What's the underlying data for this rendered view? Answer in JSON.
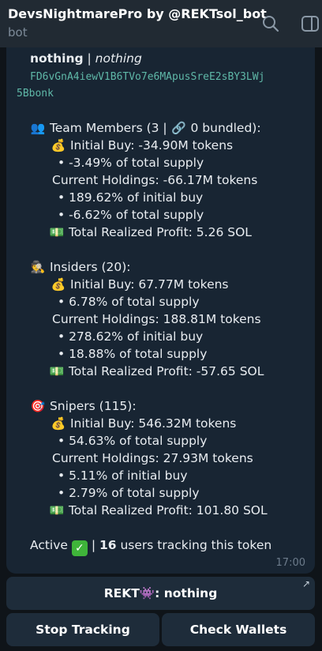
{
  "header": {
    "title": "DevsNightmarePro by @REKTsol_bot",
    "subtitle": "bot",
    "icons": [
      "search-icon",
      "side-panel-icon"
    ]
  },
  "message": {
    "name_bold": "nothing",
    "name_sep": " | ",
    "name_italic": "nothing",
    "address_line1": "FD6vGnA4iewV1B6TVo7e6MApusSreE2sBY3LWj",
    "address_line2": "5Bbonk",
    "team": {
      "emoji": "👥",
      "header": "Team Members (3 | ",
      "link_emoji": "🔗",
      "header_tail": " 0 bundled):",
      "initial_buy": "Initial Buy: -34.90M tokens",
      "initial_pct": "• -3.49% of total supply",
      "holdings": "Current Holdings: -66.17M tokens",
      "holdings_pct_buy": "• 189.62% of initial buy",
      "holdings_pct_supply": "• -6.62% of total supply",
      "profit": "Total Realized Profit: 5.26 SOL"
    },
    "insiders": {
      "emoji": "🕵",
      "header": "Insiders (20):",
      "initial_buy": "Initial Buy: 67.77M tokens",
      "initial_pct": "• 6.78% of total supply",
      "holdings": "Current Holdings: 188.81M tokens",
      "holdings_pct_buy": "• 278.62% of initial buy",
      "holdings_pct_supply": "• 18.88% of total supply",
      "profit": "Total Realized Profit: -57.65 SOL"
    },
    "snipers": {
      "emoji": "🎯",
      "header": "Snipers (115):",
      "initial_buy": "Initial Buy: 546.32M tokens",
      "initial_pct": "• 54.63% of total supply",
      "holdings": "Current Holdings: 27.93M tokens",
      "holdings_pct_buy": "• 5.11% of initial buy",
      "holdings_pct_supply": "• 2.79% of total supply",
      "profit": "Total Realized Profit: 101.80 SOL"
    },
    "bag_emoji": "💰",
    "money_emoji": "💵",
    "status_label": "Active",
    "status_check": "✓",
    "status_sep": " | ",
    "tracking_count": "16",
    "tracking_text": " users tracking this token",
    "time": "17:00"
  },
  "keyboard": {
    "rekt_prefix": "REKT",
    "rekt_emoji": "👾",
    "rekt_suffix": ": nothing",
    "rekt_arrow": "↗",
    "stop_tracking": "Stop Tracking",
    "check_wallets": "Check Wallets"
  },
  "colors": {
    "background": "#0f1419",
    "header": "#212a33",
    "bubble": "#182533",
    "button": "#1e2c3a",
    "mono_text": "#5fb8a8",
    "check_green": "#3fb43a"
  }
}
